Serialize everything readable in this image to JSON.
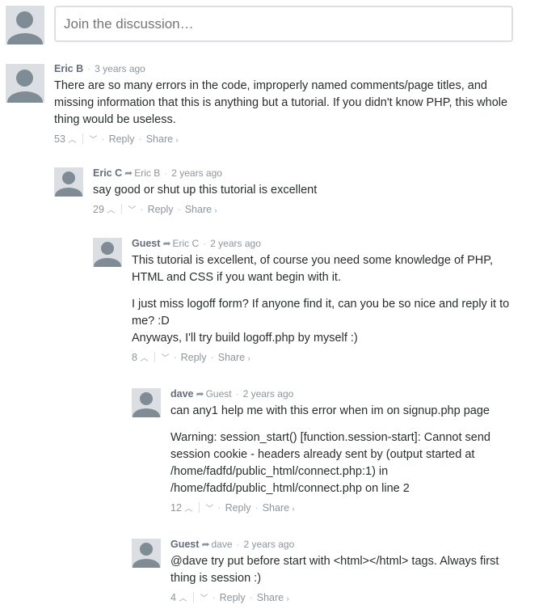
{
  "composer": {
    "placeholder": "Join the discussion…"
  },
  "arrow_glyph": "➦",
  "up_glyph": "⌃",
  "down_glyph": "⌄",
  "actions": {
    "reply": "Reply",
    "share": "Share",
    "share_suffix": "›"
  },
  "comments": [
    {
      "author": "Eric B",
      "reply_to": "",
      "time": "3 years ago",
      "paragraphs": [
        "There are so many errors in the code, improperly named comments/page titles, and missing information that this is anything but a tutorial. If you didn't know PHP, this whole thing would be useless."
      ],
      "votes": "53"
    },
    {
      "author": "Eric C",
      "reply_to": "Eric B",
      "time": "2 years ago",
      "paragraphs": [
        "say good or shut up this tutorial is excellent"
      ],
      "votes": "29"
    },
    {
      "author": "Guest",
      "reply_to": "Eric C",
      "time": "2 years ago",
      "paragraphs": [
        "This tutorial is excellent, of course you need some knowledge of PHP, HTML and CSS if you want begin with it.",
        "I just miss logoff form? If anyone find it, can you be so nice and reply it to me? :D\nAnyways, I'll try build logoff.php by myself :)"
      ],
      "votes": "8"
    },
    {
      "author": "dave",
      "reply_to": "Guest",
      "time": "2 years ago",
      "paragraphs": [
        "can any1 help me with this error when im on signup.php page",
        "Warning: session_start() [function.session-start]: Cannot send session cookie - headers already sent by (output started at /home/fadfd/public_html/connect.php:1) in /home/fadfd/public_html/connect.php on line 2"
      ],
      "votes": "12"
    },
    {
      "author": "Guest",
      "reply_to": "dave",
      "time": "2 years ago",
      "paragraphs": [
        "@dave try put before start with <html></html> tags. Always first thing is session :)"
      ],
      "votes": "4"
    }
  ]
}
